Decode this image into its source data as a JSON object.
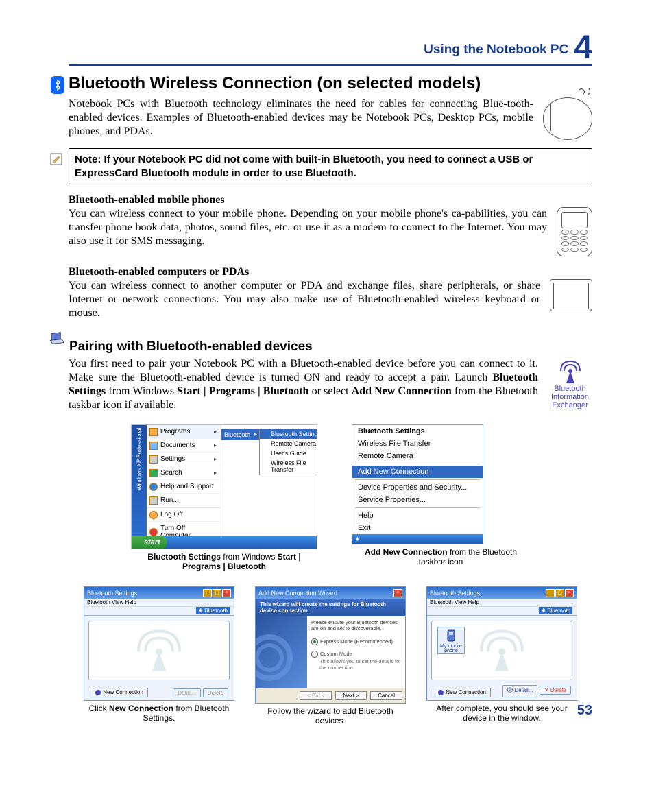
{
  "header": {
    "title": "Using the Notebook PC",
    "chapter": "4"
  },
  "section1": {
    "title": "Bluetooth Wireless Connection (on selected models)",
    "intro": "Notebook PCs with Bluetooth technology eliminates the need for cables for connecting Blue-tooth-enabled devices. Examples of Bluetooth-enabled devices may be Notebook PCs, Desktop PCs, mobile phones, and PDAs."
  },
  "note": "Note: If your Notebook PC did not come with built-in Bluetooth, you need to connect a USB or ExpressCard Bluetooth module in order to use Bluetooth.",
  "mobile": {
    "heading": "Bluetooth-enabled mobile phones",
    "text": "You can wireless connect to your mobile phone. Depending on your mobile phone's ca-pabilities, you can transfer phone book data, photos, sound files, etc. or use it as a modem to connect to the Internet. You may also use it for SMS messaging."
  },
  "pda": {
    "heading": "Bluetooth-enabled computers or PDAs",
    "text": "You can wireless connect to another computer or PDA and exchange files, share peripherals, or share Internet or network connections. You may also make use of Bluetooth-enabled wireless keyboard or mouse."
  },
  "pairing": {
    "heading": "Pairing with Bluetooth-enabled devices",
    "p1a": "You first need to pair your Notebook PC with a Bluetooth-enabled device before you can connect to it. Make sure the Bluetooth-enabled device is turned ON and ready to accept a pair. Launch ",
    "p1b": "Bluetooth Settings",
    "p1c": " from Windows ",
    "p1d": "Start | Programs | Bluetooth",
    "p1e": " or select ",
    "p1f": "Add New Connection",
    "p1g": " from the Bluetooth taskbar icon if available.",
    "antenna": "Bluetooth Information Exchanger"
  },
  "start_menu": {
    "sidebar": "Windows XP Professional",
    "items": [
      "Programs",
      "Documents",
      "Settings",
      "Search",
      "Help and Support",
      "Run...",
      "Log Off",
      "Turn Off Computer..."
    ],
    "sub1": "Bluetooth",
    "sub2": [
      "Bluetooth Settings",
      "Remote Camera",
      "User's Guide",
      "Wireless File Transfer"
    ],
    "start_btn": "start",
    "caption_a": "Bluetooth Settings",
    "caption_b": " from Windows ",
    "caption_c": "Start | Programs | Bluetooth"
  },
  "context_menu": {
    "items_top": [
      "Bluetooth Settings",
      "Wireless File Transfer",
      "Remote Camera"
    ],
    "highlight": "Add New Connection",
    "items_mid": [
      "Device Properties and Security...",
      "Service Properties..."
    ],
    "items_bot": [
      "Help",
      "Exit"
    ],
    "caption_a": "Add New Connection",
    "caption_b": " from the Bluetooth taskbar icon"
  },
  "shot1": {
    "title": "Bluetooth Settings",
    "menu": "Bluetooth   View   Help",
    "bt_logo": "Bluetooth",
    "new_conn": "New Connection",
    "btn_detail": "Detail...",
    "btn_delete": "Delete",
    "caption_a": "Click ",
    "caption_b": "New Connection",
    "caption_c": " from Bluetooth Settings."
  },
  "shot2": {
    "title": "Add New Connection Wizard",
    "banner": "This wizard will create the settings for Bluetooth device connection.",
    "please": "Please ensure your Bluetooth devices are on and set to discoverable.",
    "express": "Express Mode (Recommended)",
    "custom": "Custom Mode",
    "custom_sub": "This allows you to set the details for the connection.",
    "back": "< Back",
    "next": "Next >",
    "cancel": "Cancel",
    "caption": "Follow the wizard to add Bluetooth devices."
  },
  "shot3": {
    "title": "Bluetooth Settings",
    "menu": "Bluetooth   View   Help",
    "bt_logo": "Bluetooth",
    "device": "My mobile phone",
    "new_conn": "New Connection",
    "btn_detail": "Detail...",
    "btn_delete": "Delete",
    "caption": "After complete, you should see your device in the window."
  },
  "page_number": "53"
}
